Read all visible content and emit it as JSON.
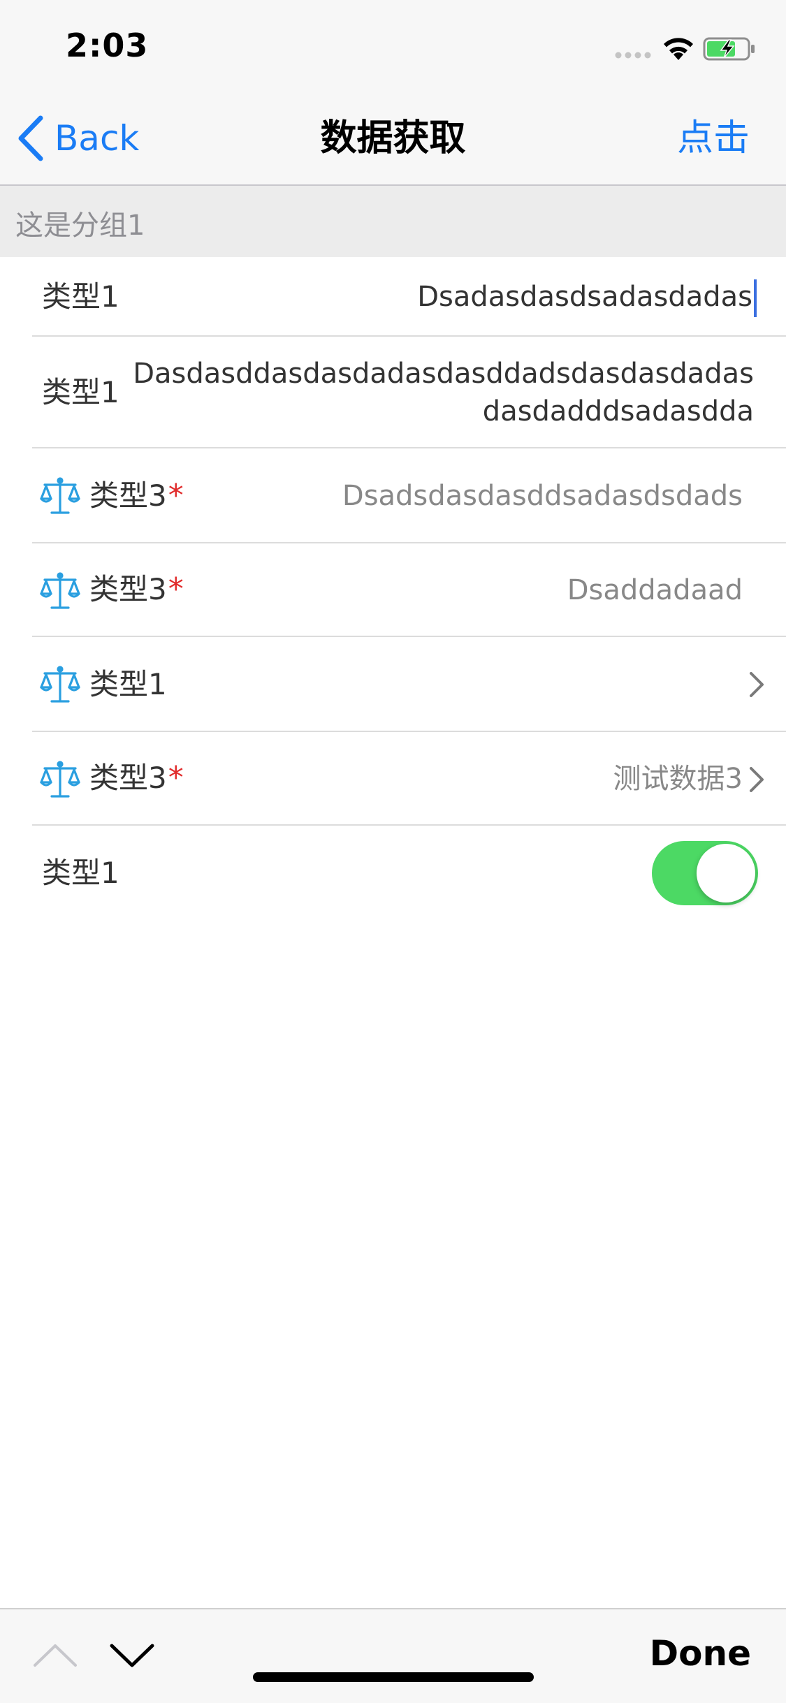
{
  "status_bar": {
    "time": "2:03",
    "signal_icon": "signal-dots-icon",
    "wifi_icon": "wifi-icon",
    "battery_icon": "battery-charging-icon",
    "battery_color": "#4cd964"
  },
  "nav": {
    "back_label": "Back",
    "title": "数据获取",
    "right_action": "点击",
    "accent_color": "#1a7cf5"
  },
  "section": {
    "header": "这是分组1"
  },
  "rows": [
    {
      "label": "类型1",
      "value": "Dsadasdasdsadasdadas",
      "icon": null,
      "required": false,
      "editing": true
    },
    {
      "label": "类型1",
      "value_line1": "Dasdasddasdasdadasdasddadsdasdasdadas",
      "value_line2": "dasdadddsadasdda",
      "icon": null,
      "required": false
    },
    {
      "label": "类型3",
      "value": "Dsadsdasdasddsadasdsdads",
      "icon": "balance-scale-icon",
      "required": true
    },
    {
      "label": "类型3",
      "value": "Dsaddadaad",
      "icon": "balance-scale-icon",
      "required": true
    },
    {
      "label": "类型1",
      "value": "",
      "icon": "balance-scale-icon",
      "required": false,
      "disclosure": true
    },
    {
      "label": "类型3",
      "value": "测试数据3",
      "icon": "balance-scale-icon",
      "required": true,
      "disclosure": true
    },
    {
      "label": "类型1",
      "toggle_on": true,
      "icon": null,
      "required": false
    }
  ],
  "required_mark": "*",
  "required_color": "#e12b2b",
  "toggle_color": "#4cd964",
  "accessory": {
    "prev_icon": "chevron-up-icon",
    "next_icon": "chevron-down-icon",
    "done_label": "Done"
  }
}
